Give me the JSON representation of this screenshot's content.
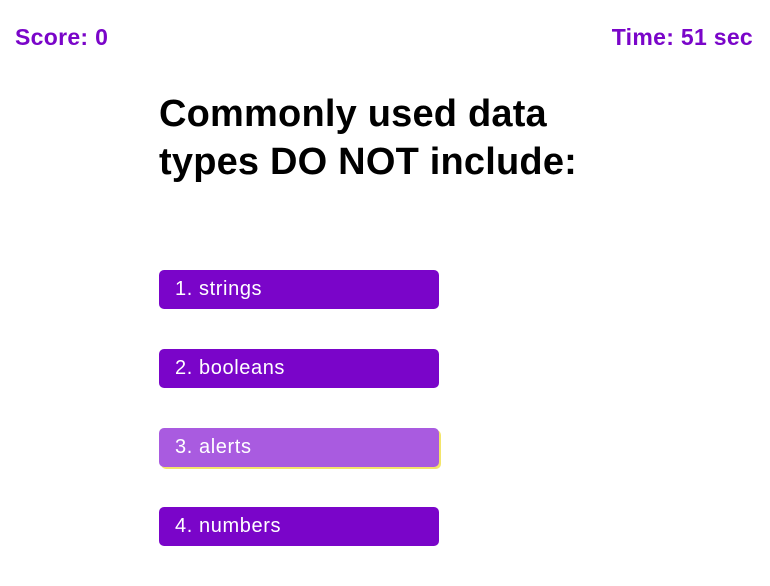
{
  "header": {
    "score": "Score: 0",
    "timer": "Time: 51 sec"
  },
  "question": {
    "text": "Commonly used data types DO NOT include:"
  },
  "answers": [
    {
      "label": "1. strings"
    },
    {
      "label": "2. booleans"
    },
    {
      "label": "3. alerts"
    },
    {
      "label": "4. numbers"
    }
  ],
  "colors": {
    "accent": "#7a05c9",
    "accent_hover": "#a95be0",
    "hover_outline": "#f3e56a",
    "question_text": "#000000"
  }
}
